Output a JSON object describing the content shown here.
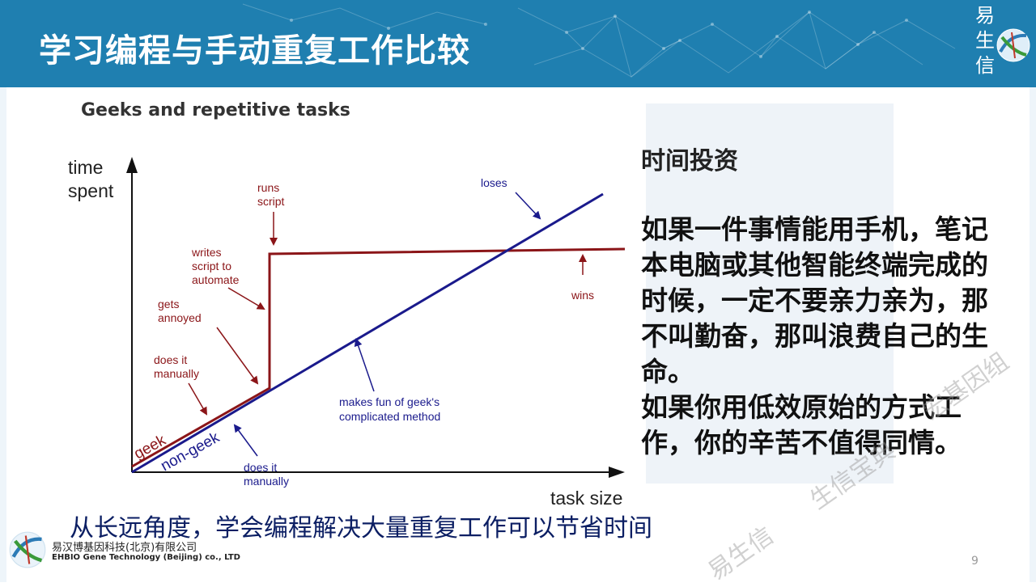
{
  "slide": {
    "title": "学习编程与手动重复工作比较",
    "brand_vertical": "易生信",
    "page_number": "9",
    "watermark": [
      "易生信",
      "生信宝典",
      "宏基因组"
    ]
  },
  "chart": {
    "title": "Geeks and repetitive tasks",
    "y_axis_label": [
      "time",
      "spent"
    ],
    "x_axis_label": "task size",
    "annotations": {
      "runs_script": [
        "runs",
        "script"
      ],
      "writes_script": [
        "writes",
        "script to",
        "automate"
      ],
      "gets_annoyed": [
        "gets",
        "annoyed"
      ],
      "does_it_manually_geek": [
        "does it",
        "manually"
      ],
      "geek": "geek",
      "non_geek": "non-geek",
      "does_it_manually_nongeek": [
        "does it",
        "manually"
      ],
      "makes_fun": [
        "makes fun of geek's",
        "complicated method"
      ],
      "loses": "loses",
      "wins": "wins"
    },
    "colors": {
      "geek": "#8b1518",
      "non_geek": "#1a1a8c",
      "axis": "#111111"
    }
  },
  "side_panel": {
    "heading": "时间投资",
    "paragraph_1": "如果一件事情能用手机，笔记本电脑或其他智能终端完成的时候，一定不要亲力亲为，那不叫勤奋，那叫浪费自己的生命。",
    "paragraph_2": "如果你用低效原始的方式工作，你的辛苦不值得同情。"
  },
  "bottom_note": "从长远角度，学会编程解决大量重复工作可以节省时间",
  "company": {
    "name_cn": "易汉博基因科技(北京)有限公司",
    "name_en": "EHBIO Gene Technology (Beijing) co., LTD"
  }
}
